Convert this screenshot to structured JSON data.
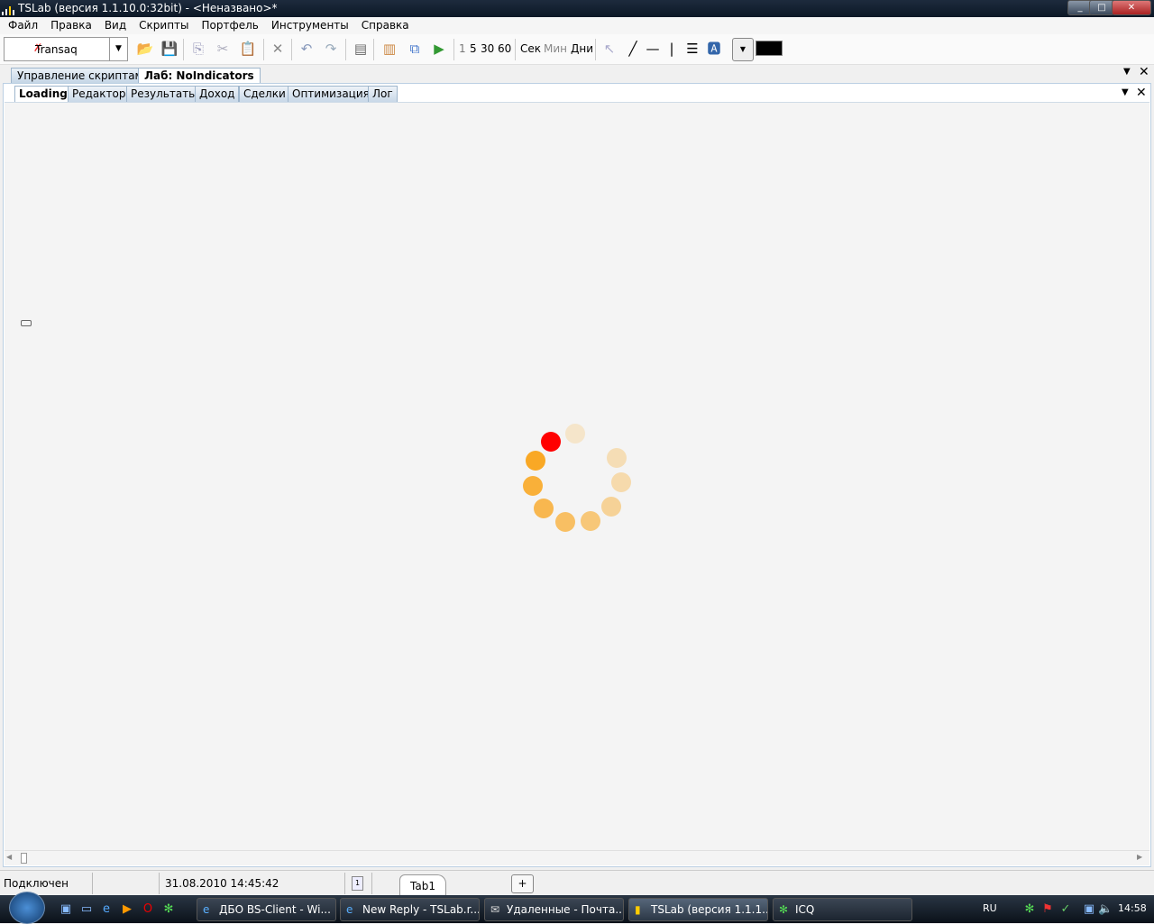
{
  "window": {
    "title": "TSLab (версия 1.1.10.0:32bit) - <Неназвано>*",
    "minimize": "_",
    "maximize": "□",
    "close": "✕"
  },
  "menu": [
    "Файл",
    "Правка",
    "Вид",
    "Скрипты",
    "Портфель",
    "Инструменты",
    "Справка"
  ],
  "toolbar": {
    "connector": "Transaq",
    "intervals": [
      "1",
      "5",
      "30",
      "60"
    ],
    "units": [
      "Сек",
      "Мин",
      "Дни"
    ]
  },
  "tabs": [
    {
      "label": "Управление скриптами"
    },
    {
      "label": "Лаб: NoIndicators"
    }
  ],
  "subtabs": [
    {
      "label": "Loading"
    },
    {
      "label": "Редактор"
    },
    {
      "label": "Результаты"
    },
    {
      "label": "Доход"
    },
    {
      "label": "Сделки"
    },
    {
      "label": "Оптимизация"
    },
    {
      "label": "Лог"
    }
  ],
  "status": {
    "connection": "Подключен",
    "datetime": "31.08.2010 14:45:42",
    "page_icon": "1",
    "tab": "Tab1",
    "add": "+"
  },
  "taskbar": {
    "items": [
      "ДБО BS-Client - Wi...",
      "New Reply - TSLab.r...",
      "Удаленные - Почта...",
      "TSLab (версия 1.1.1...",
      "ICQ"
    ],
    "lang": "RU",
    "clock": "14:58"
  },
  "colors": {
    "spinner_active": "#ff0000",
    "spinner": "#f9a825"
  }
}
